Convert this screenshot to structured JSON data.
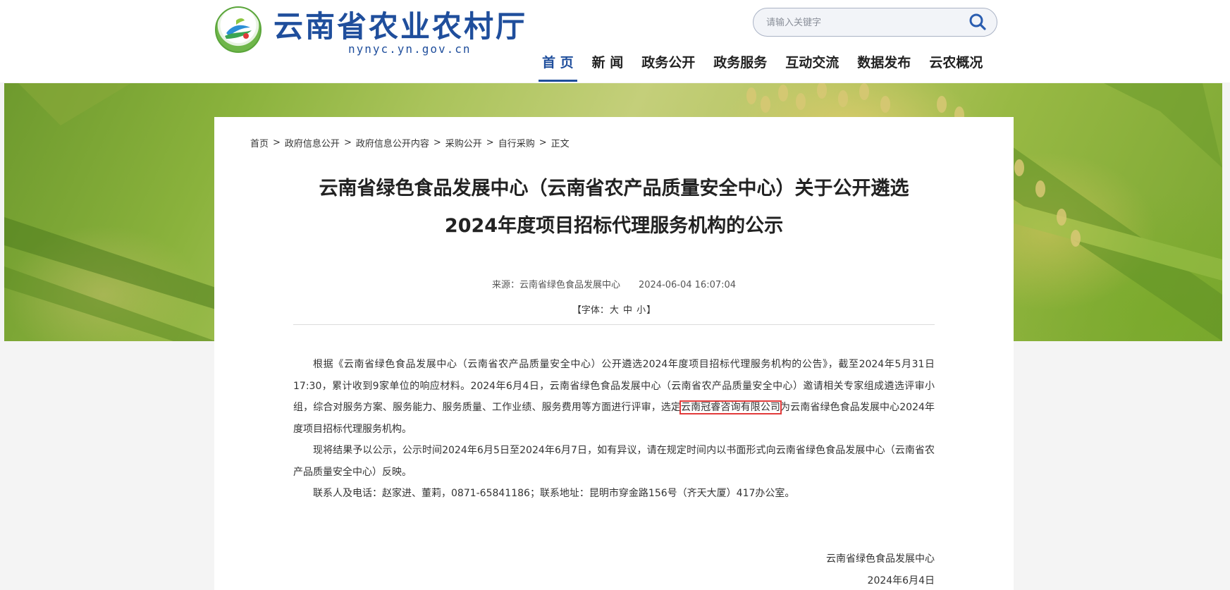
{
  "header": {
    "site_name": "云南省农业农村厅",
    "domain": "nynyc.yn.gov.cn",
    "search": {
      "placeholder": "请输入关键字"
    },
    "nav": [
      {
        "label": "首 页",
        "active": true
      },
      {
        "label": "新 闻",
        "active": false
      },
      {
        "label": "政务公开",
        "active": false
      },
      {
        "label": "政务服务",
        "active": false
      },
      {
        "label": "互动交流",
        "active": false
      },
      {
        "label": "数据发布",
        "active": false
      },
      {
        "label": "云农概况",
        "active": false
      }
    ],
    "accent_color": "#1f4e9c"
  },
  "breadcrumb": {
    "items": [
      "首页",
      "政府信息公开",
      "政府信息公开内容",
      "采购公开",
      "自行采购"
    ],
    "separator": ">",
    "current": "正文"
  },
  "article": {
    "title_line1": "云南省绿色食品发展中心（云南省农产品质量安全中心）关于公开遴选",
    "title_line2": "2024年度项目招标代理服务机构的公示",
    "source": "来源：云南省绿色食品发展中心",
    "datetime": "2024-06-04 16:07:04",
    "font_size": {
      "open": "【字体：",
      "large": "大",
      "medium": "中",
      "small": "小",
      "close": "】"
    },
    "paragraph1_before": "根据《云南省绿色食品发展中心（云南省农产品质量安全中心）公开遴选2024年度项目招标代理服务机构的公告》，截至2024年5月31日17:30，累计收到9家单位的响应材料。2024年6月4日，云南省绿色食品发展中心（云南省农产品质量安全中心）邀请相关专家组成遴选评审小组，综合对服务方案、服务能力、服务质量、工作业绩、服务费用等方面进行评审，选定",
    "paragraph1_highlight": "云南冠睿咨询有限公司",
    "paragraph1_after": "为云南省绿色食品发展中心2024年度项目招标代理服务机构。",
    "paragraph2": "现将结果予以公示，公示时间2024年6月5日至2024年6月7日，如有异议，请在规定时间内以书面形式向云南省绿色食品发展中心（云南省农产品质量安全中心）反映。",
    "paragraph3": "联系人及电话：赵家进、董莉，0871-65841186；联系地址：昆明市穿金路156号（齐天大厦）417办公室。",
    "signature_org": "云南省绿色食品发展中心",
    "signature_date": "2024年6月4日",
    "highlight_color": "#e23b3b"
  }
}
